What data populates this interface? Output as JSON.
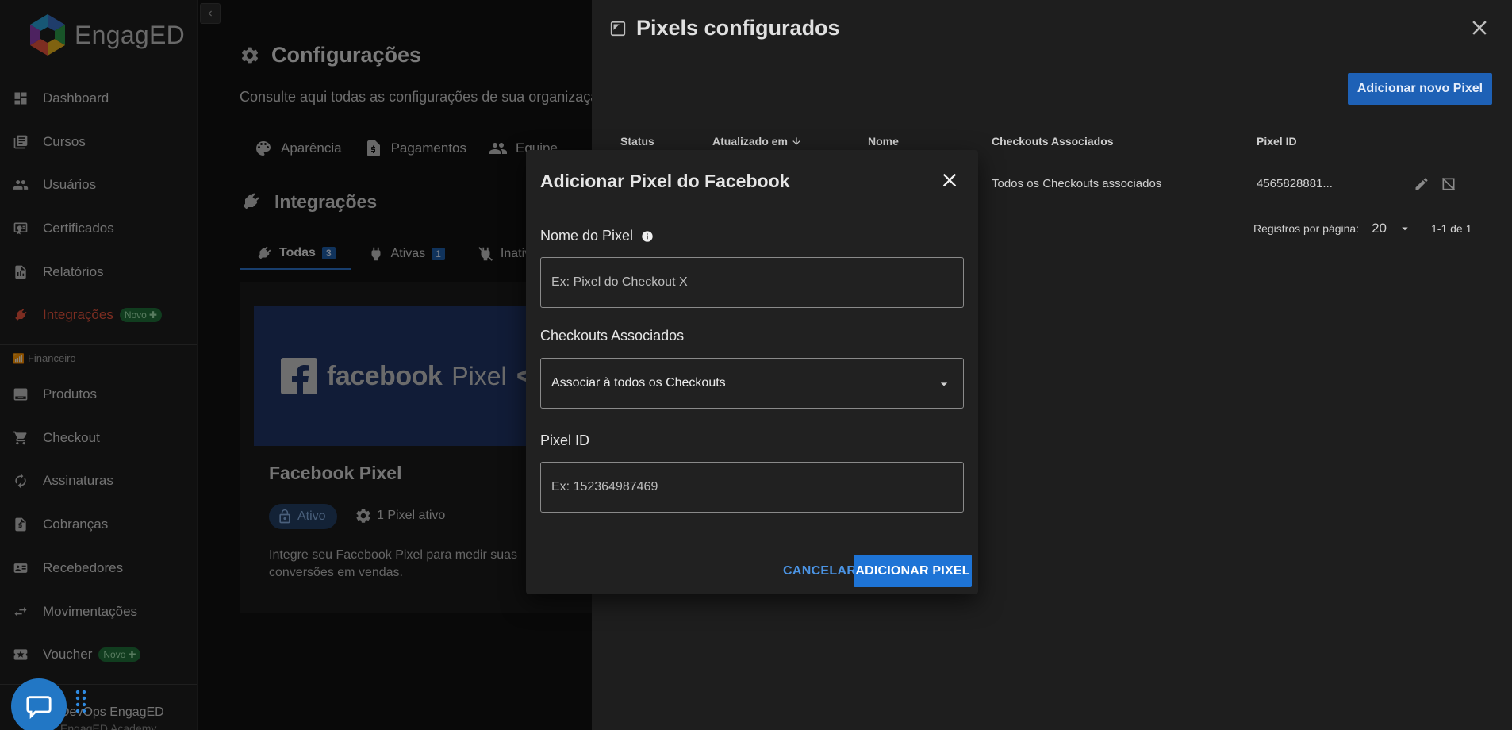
{
  "app": {
    "name": "EngagED"
  },
  "sidebar": {
    "items": [
      {
        "label": "Dashboard",
        "icon": "dashboard-icon"
      },
      {
        "label": "Cursos",
        "icon": "courses-icon"
      },
      {
        "label": "Usuários",
        "icon": "users-icon"
      },
      {
        "label": "Certificados",
        "icon": "certificate-icon"
      },
      {
        "label": "Relatórios",
        "icon": "reports-icon"
      },
      {
        "label": "Integrações",
        "icon": "plug-icon",
        "active": true,
        "badge": "Novo"
      }
    ],
    "section_label": "Financeiro",
    "finance_items": [
      {
        "label": "Produtos",
        "icon": "products-icon"
      },
      {
        "label": "Checkout",
        "icon": "cart-icon"
      },
      {
        "label": "Assinaturas",
        "icon": "refresh-icon"
      },
      {
        "label": "Cobranças",
        "icon": "invoice-icon"
      },
      {
        "label": "Recebedores",
        "icon": "receiver-icon"
      },
      {
        "label": "Movimentações",
        "icon": "swap-icon"
      },
      {
        "label": "Voucher",
        "icon": "voucher-icon",
        "badge": "Novo"
      }
    ],
    "footer_name": "DevOps EngagED",
    "footer_sub": "EngagED Academy"
  },
  "main": {
    "title": "Configurações",
    "subtitle": "Consulte aqui todas as configurações de sua organização",
    "settings_tabs": [
      {
        "label": "Aparência",
        "icon": "palette-icon"
      },
      {
        "label": "Pagamentos",
        "icon": "payment-doc-icon"
      },
      {
        "label": "Equipe",
        "icon": "team-icon"
      }
    ],
    "integrations_title": "Integrações",
    "filter_tabs": [
      {
        "label": "Todas",
        "count": "3",
        "icon": "plug-icon"
      },
      {
        "label": "Ativas",
        "count": "1",
        "icon": "plug-on-icon"
      },
      {
        "label": "Inativas",
        "icon": "plug-off-icon"
      }
    ],
    "card": {
      "banner_brand": "facebook",
      "banner_product": "Pixel",
      "banner_code": "</>",
      "title": "Facebook Pixel",
      "status": "Ativo",
      "pixel_count": "1 Pixel ativo",
      "description": "Integre seu Facebook Pixel para medir suas conversões em vendas."
    }
  },
  "drawer": {
    "title": "Pixels configurados",
    "add_button": "Adicionar novo Pixel",
    "columns": {
      "status": "Status",
      "updated": "Atualizado em",
      "name": "Nome",
      "checkouts": "Checkouts Associados",
      "pixel_id": "Pixel ID"
    },
    "rows": [
      {
        "checkouts": "Todos os Checkouts associados",
        "pixel_id": "4565828881..."
      }
    ],
    "pagination": {
      "label": "Registros por página:",
      "per_page": "20",
      "range": "1-1 de 1"
    }
  },
  "modal": {
    "title": "Adicionar Pixel do Facebook",
    "name_label": "Nome do Pixel",
    "name_placeholder": "Ex: Pixel do Checkout X",
    "checkouts_label": "Checkouts Associados",
    "checkouts_value": "Associar à todos os Checkouts",
    "pixel_id_label": "Pixel ID",
    "pixel_id_placeholder": "Ex: 152364987469",
    "cancel_label": "CANCELAR",
    "submit_label": "ADICIONAR PIXEL"
  },
  "colors": {
    "accent_blue": "#1e74d6",
    "active_red": "#e3533d",
    "badge_green": "#1f6f3a"
  }
}
